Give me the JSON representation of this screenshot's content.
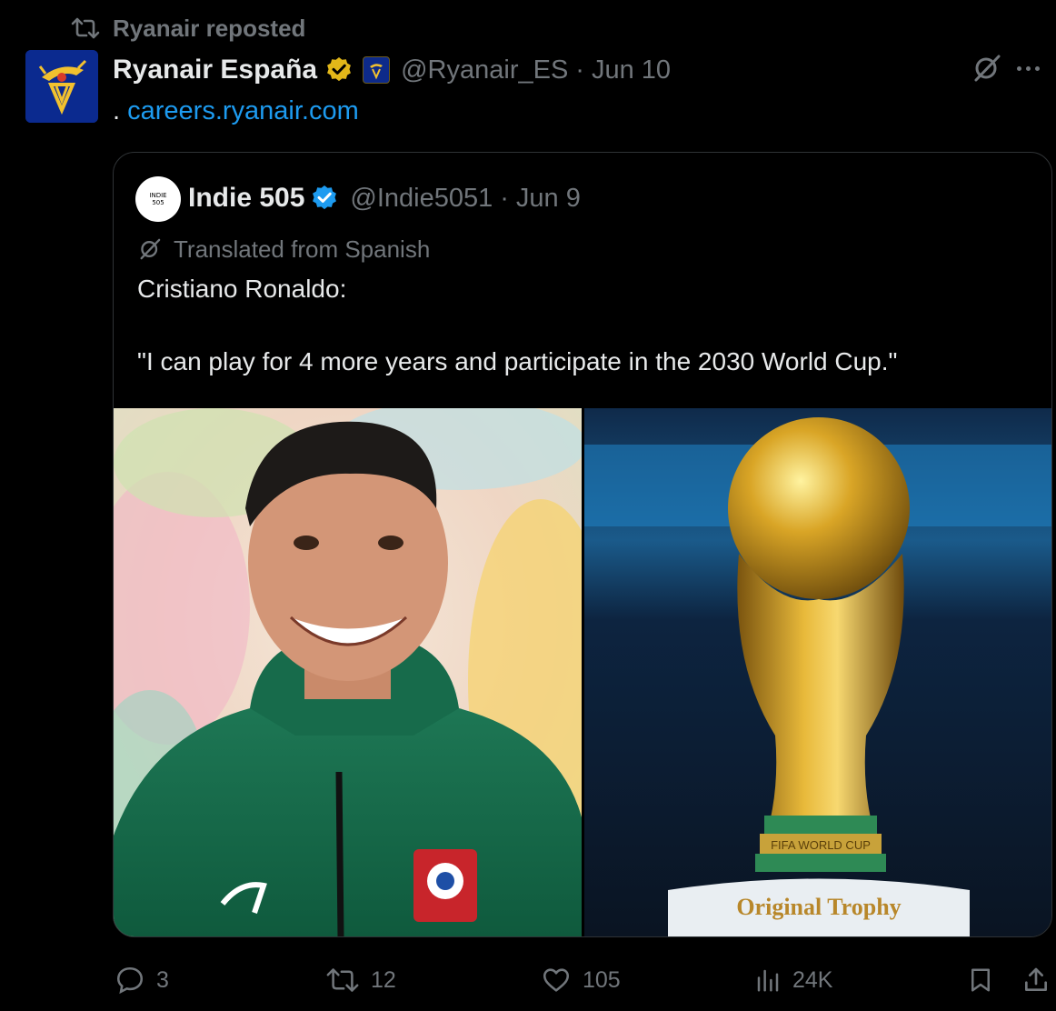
{
  "repost": {
    "label": "Ryanair reposted"
  },
  "post": {
    "display_name": "Ryanair España",
    "handle": "@Ryanair_ES",
    "separator": "·",
    "date": "Jun 10",
    "body_prefix": ".",
    "link_text": "careers.ryanair.com"
  },
  "quote": {
    "avatar_text_1": "INDIE",
    "avatar_text_2": "505",
    "display_name": "Indie 505",
    "handle": "@Indie5051",
    "separator": "·",
    "date": "Jun 9",
    "translated_label": "Translated from Spanish",
    "text_line1": "Cristiano Ronaldo:",
    "text_line2": "\"I can play for 4 more years and participate in the 2030 World Cup.\"",
    "media_right_caption": "Original Trophy",
    "trophy_band_text": "FIFA WORLD CUP"
  },
  "actions": {
    "replies": "3",
    "reposts": "12",
    "likes": "105",
    "views": "24K"
  },
  "colors": {
    "background": "#000000",
    "text_primary": "#e7e9ea",
    "text_muted": "#71767b",
    "link": "#1d9bf0",
    "verified_blue": "#1d9bf0",
    "verified_gold": "#e2b719",
    "border": "#2f3336"
  },
  "icons": [
    "repost-icon",
    "verified-gold-icon",
    "affiliate-badge-icon",
    "grok-icon",
    "more-icon",
    "verified-blue-icon",
    "translate-icon",
    "reply-icon",
    "like-icon",
    "views-icon",
    "bookmark-icon",
    "share-icon"
  ]
}
